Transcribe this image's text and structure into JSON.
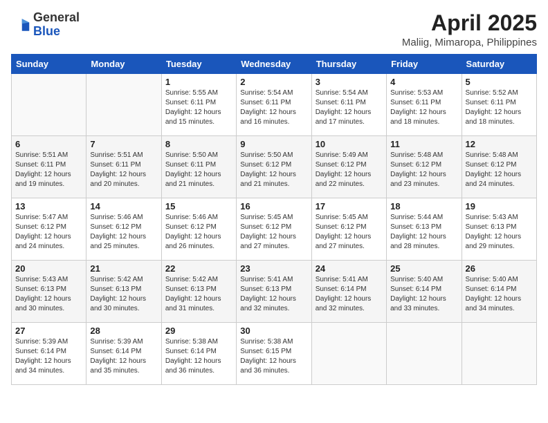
{
  "header": {
    "logo_line1": "General",
    "logo_line2": "Blue",
    "title": "April 2025",
    "subtitle": "Maliig, Mimaropa, Philippines"
  },
  "columns": [
    "Sunday",
    "Monday",
    "Tuesday",
    "Wednesday",
    "Thursday",
    "Friday",
    "Saturday"
  ],
  "weeks": [
    [
      {
        "day": "",
        "sunrise": "",
        "sunset": "",
        "daylight": ""
      },
      {
        "day": "",
        "sunrise": "",
        "sunset": "",
        "daylight": ""
      },
      {
        "day": "1",
        "sunrise": "Sunrise: 5:55 AM",
        "sunset": "Sunset: 6:11 PM",
        "daylight": "Daylight: 12 hours and 15 minutes."
      },
      {
        "day": "2",
        "sunrise": "Sunrise: 5:54 AM",
        "sunset": "Sunset: 6:11 PM",
        "daylight": "Daylight: 12 hours and 16 minutes."
      },
      {
        "day": "3",
        "sunrise": "Sunrise: 5:54 AM",
        "sunset": "Sunset: 6:11 PM",
        "daylight": "Daylight: 12 hours and 17 minutes."
      },
      {
        "day": "4",
        "sunrise": "Sunrise: 5:53 AM",
        "sunset": "Sunset: 6:11 PM",
        "daylight": "Daylight: 12 hours and 18 minutes."
      },
      {
        "day": "5",
        "sunrise": "Sunrise: 5:52 AM",
        "sunset": "Sunset: 6:11 PM",
        "daylight": "Daylight: 12 hours and 18 minutes."
      }
    ],
    [
      {
        "day": "6",
        "sunrise": "Sunrise: 5:51 AM",
        "sunset": "Sunset: 6:11 PM",
        "daylight": "Daylight: 12 hours and 19 minutes."
      },
      {
        "day": "7",
        "sunrise": "Sunrise: 5:51 AM",
        "sunset": "Sunset: 6:11 PM",
        "daylight": "Daylight: 12 hours and 20 minutes."
      },
      {
        "day": "8",
        "sunrise": "Sunrise: 5:50 AM",
        "sunset": "Sunset: 6:11 PM",
        "daylight": "Daylight: 12 hours and 21 minutes."
      },
      {
        "day": "9",
        "sunrise": "Sunrise: 5:50 AM",
        "sunset": "Sunset: 6:12 PM",
        "daylight": "Daylight: 12 hours and 21 minutes."
      },
      {
        "day": "10",
        "sunrise": "Sunrise: 5:49 AM",
        "sunset": "Sunset: 6:12 PM",
        "daylight": "Daylight: 12 hours and 22 minutes."
      },
      {
        "day": "11",
        "sunrise": "Sunrise: 5:48 AM",
        "sunset": "Sunset: 6:12 PM",
        "daylight": "Daylight: 12 hours and 23 minutes."
      },
      {
        "day": "12",
        "sunrise": "Sunrise: 5:48 AM",
        "sunset": "Sunset: 6:12 PM",
        "daylight": "Daylight: 12 hours and 24 minutes."
      }
    ],
    [
      {
        "day": "13",
        "sunrise": "Sunrise: 5:47 AM",
        "sunset": "Sunset: 6:12 PM",
        "daylight": "Daylight: 12 hours and 24 minutes."
      },
      {
        "day": "14",
        "sunrise": "Sunrise: 5:46 AM",
        "sunset": "Sunset: 6:12 PM",
        "daylight": "Daylight: 12 hours and 25 minutes."
      },
      {
        "day": "15",
        "sunrise": "Sunrise: 5:46 AM",
        "sunset": "Sunset: 6:12 PM",
        "daylight": "Daylight: 12 hours and 26 minutes."
      },
      {
        "day": "16",
        "sunrise": "Sunrise: 5:45 AM",
        "sunset": "Sunset: 6:12 PM",
        "daylight": "Daylight: 12 hours and 27 minutes."
      },
      {
        "day": "17",
        "sunrise": "Sunrise: 5:45 AM",
        "sunset": "Sunset: 6:12 PM",
        "daylight": "Daylight: 12 hours and 27 minutes."
      },
      {
        "day": "18",
        "sunrise": "Sunrise: 5:44 AM",
        "sunset": "Sunset: 6:13 PM",
        "daylight": "Daylight: 12 hours and 28 minutes."
      },
      {
        "day": "19",
        "sunrise": "Sunrise: 5:43 AM",
        "sunset": "Sunset: 6:13 PM",
        "daylight": "Daylight: 12 hours and 29 minutes."
      }
    ],
    [
      {
        "day": "20",
        "sunrise": "Sunrise: 5:43 AM",
        "sunset": "Sunset: 6:13 PM",
        "daylight": "Daylight: 12 hours and 30 minutes."
      },
      {
        "day": "21",
        "sunrise": "Sunrise: 5:42 AM",
        "sunset": "Sunset: 6:13 PM",
        "daylight": "Daylight: 12 hours and 30 minutes."
      },
      {
        "day": "22",
        "sunrise": "Sunrise: 5:42 AM",
        "sunset": "Sunset: 6:13 PM",
        "daylight": "Daylight: 12 hours and 31 minutes."
      },
      {
        "day": "23",
        "sunrise": "Sunrise: 5:41 AM",
        "sunset": "Sunset: 6:13 PM",
        "daylight": "Daylight: 12 hours and 32 minutes."
      },
      {
        "day": "24",
        "sunrise": "Sunrise: 5:41 AM",
        "sunset": "Sunset: 6:14 PM",
        "daylight": "Daylight: 12 hours and 32 minutes."
      },
      {
        "day": "25",
        "sunrise": "Sunrise: 5:40 AM",
        "sunset": "Sunset: 6:14 PM",
        "daylight": "Daylight: 12 hours and 33 minutes."
      },
      {
        "day": "26",
        "sunrise": "Sunrise: 5:40 AM",
        "sunset": "Sunset: 6:14 PM",
        "daylight": "Daylight: 12 hours and 34 minutes."
      }
    ],
    [
      {
        "day": "27",
        "sunrise": "Sunrise: 5:39 AM",
        "sunset": "Sunset: 6:14 PM",
        "daylight": "Daylight: 12 hours and 34 minutes."
      },
      {
        "day": "28",
        "sunrise": "Sunrise: 5:39 AM",
        "sunset": "Sunset: 6:14 PM",
        "daylight": "Daylight: 12 hours and 35 minutes."
      },
      {
        "day": "29",
        "sunrise": "Sunrise: 5:38 AM",
        "sunset": "Sunset: 6:14 PM",
        "daylight": "Daylight: 12 hours and 36 minutes."
      },
      {
        "day": "30",
        "sunrise": "Sunrise: 5:38 AM",
        "sunset": "Sunset: 6:15 PM",
        "daylight": "Daylight: 12 hours and 36 minutes."
      },
      {
        "day": "",
        "sunrise": "",
        "sunset": "",
        "daylight": ""
      },
      {
        "day": "",
        "sunrise": "",
        "sunset": "",
        "daylight": ""
      },
      {
        "day": "",
        "sunrise": "",
        "sunset": "",
        "daylight": ""
      }
    ]
  ]
}
